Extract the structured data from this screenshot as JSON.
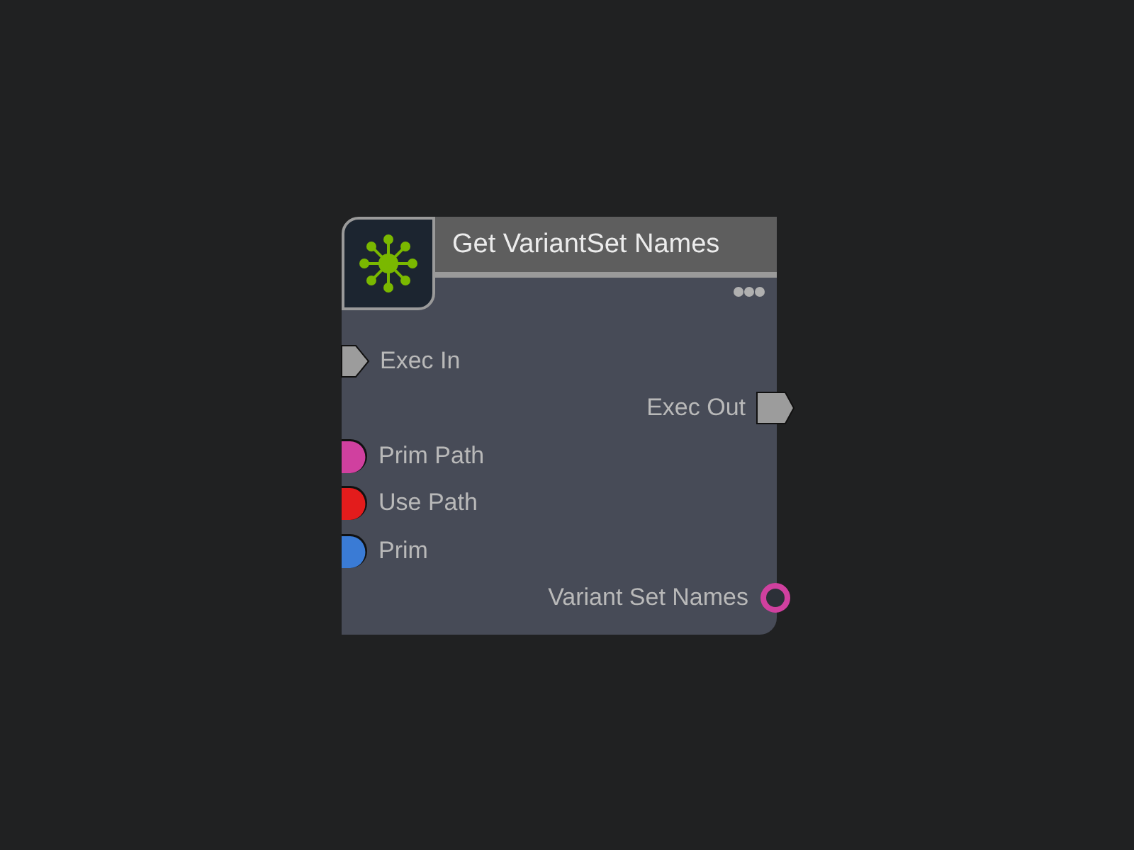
{
  "node": {
    "title": "Get VariantSet Names",
    "pins": [
      {
        "label": "Exec In",
        "kind": "exec_in"
      },
      {
        "label": "Exec Out",
        "kind": "exec_out"
      },
      {
        "label": "Prim Path",
        "kind": "data_in",
        "color": "#d0409f"
      },
      {
        "label": "Use Path",
        "kind": "data_in",
        "color": "#e31c1c"
      },
      {
        "label": "Prim",
        "kind": "data_in",
        "color": "#3a7bd5"
      },
      {
        "label": "Variant Set Names",
        "kind": "data_out",
        "color": "#d0409f"
      }
    ]
  }
}
